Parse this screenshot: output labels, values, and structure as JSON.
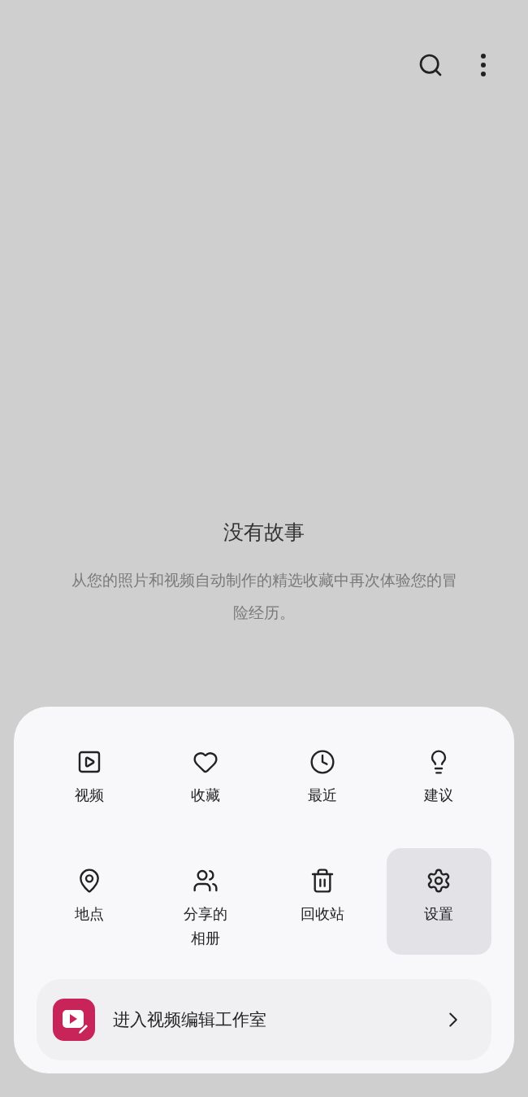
{
  "empty_state": {
    "title": "没有故事",
    "description": "从您的照片和视频自动制作的精选收藏中再次体验您的冒险经历。"
  },
  "menu": {
    "items": [
      {
        "label": "视频",
        "selected": false
      },
      {
        "label": "收藏",
        "selected": false
      },
      {
        "label": "最近",
        "selected": false
      },
      {
        "label": "建议",
        "selected": false
      },
      {
        "label": "地点",
        "selected": false
      },
      {
        "label": "分享的相册",
        "selected": false
      },
      {
        "label": "回收站",
        "selected": false
      },
      {
        "label": "设置",
        "selected": true
      }
    ],
    "banner": {
      "label": "进入视频编辑工作室"
    }
  }
}
